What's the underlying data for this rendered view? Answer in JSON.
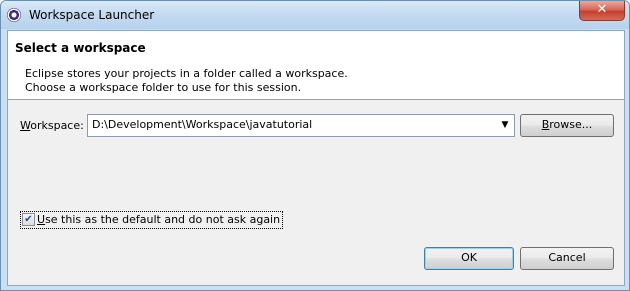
{
  "window": {
    "title": "Workspace Launcher",
    "close_glyph": "✕"
  },
  "header": {
    "title": "Select a workspace",
    "description_line1": "Eclipse stores your projects in a folder called a workspace.",
    "description_line2": "Choose a workspace folder to use for this session."
  },
  "workspace": {
    "label_accesskey": "W",
    "label_rest": "orkspace:",
    "value": "D:\\Development\\Workspace\\javatutorial",
    "dropdown_glyph": "▼"
  },
  "browse": {
    "label_accesskey": "B",
    "label_rest": "rowse..."
  },
  "default_option": {
    "checked": true,
    "check_glyph": "✔",
    "label_accesskey": "U",
    "label_rest": "se this as the default and do not ask again"
  },
  "actions": {
    "ok_label": "OK",
    "cancel_label": "Cancel"
  }
}
